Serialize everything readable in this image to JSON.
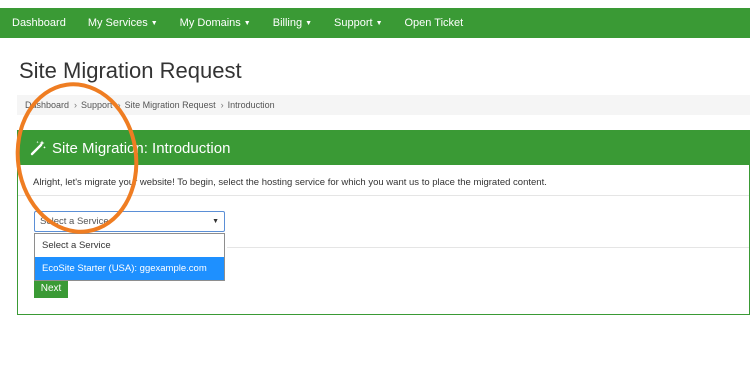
{
  "nav": {
    "items": [
      {
        "label": "Dashboard",
        "caret": ""
      },
      {
        "label": "My Services",
        "caret": "▼"
      },
      {
        "label": "My Domains",
        "caret": "▼"
      },
      {
        "label": "Billing",
        "caret": "▼"
      },
      {
        "label": "Support",
        "caret": "▼"
      },
      {
        "label": "Open Ticket",
        "caret": ""
      }
    ]
  },
  "page": {
    "title": "Site Migration Request"
  },
  "breadcrumb": {
    "items": [
      "Dashboard",
      "Support",
      "Site Migration Request",
      "Introduction"
    ],
    "separator": "›"
  },
  "panel": {
    "title": "Site Migration: Introduction",
    "icon": "magic-wand-icon",
    "intro": "Alright, let's migrate your website! To begin, select the hosting service for which you want us to place the migrated content."
  },
  "service_select": {
    "selected": "Select a Service",
    "options": [
      "Select a Service",
      "EcoSite Starter (USA): ggexample.com"
    ],
    "highlighted_index": 1
  },
  "actions": {
    "next_label": "Next"
  },
  "colors": {
    "brand_green": "#3a9a35",
    "annotation_orange": "#ef7d22",
    "highlight_blue": "#1e90ff"
  }
}
